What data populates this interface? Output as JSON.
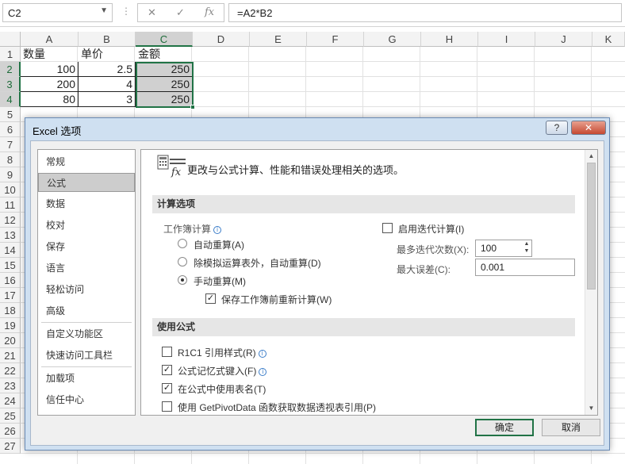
{
  "formula_bar": {
    "name_box": "C2",
    "dots": "⋮",
    "cancel_icon": "✕",
    "enter_icon": "✓",
    "fx_label": "fx",
    "formula": "=A2*B2"
  },
  "columns": [
    "A",
    "B",
    "C",
    "D",
    "E",
    "F",
    "G",
    "H",
    "I",
    "J",
    "K"
  ],
  "rows": [
    "1",
    "2",
    "3",
    "4",
    "5",
    "6",
    "7",
    "8",
    "9",
    "10",
    "11",
    "12",
    "13",
    "14",
    "15",
    "16",
    "17",
    "18",
    "19",
    "20",
    "21",
    "22",
    "23",
    "24",
    "25",
    "26",
    "27"
  ],
  "cells": {
    "a1": "数量",
    "b1": "单价",
    "c1": "金额",
    "a2": "100",
    "b2": "2.5",
    "c2": "250",
    "a3": "200",
    "b3": "4",
    "c3": "250",
    "a4": "80",
    "b4": "3",
    "c4": "250"
  },
  "dialog": {
    "title": "Excel 选项",
    "help_btn": "?",
    "close_btn": "✕",
    "nav": [
      "常规",
      "公式",
      "数据",
      "校对",
      "保存",
      "语言",
      "轻松访问",
      "高级",
      "自定义功能区",
      "快速访问工具栏",
      "加载项",
      "信任中心"
    ],
    "header_icon_label": "fx",
    "header_text": "更改与公式计算、性能和错误处理相关的选项。",
    "calc_section": "计算选项",
    "workbook_calc": "工作簿计算",
    "info_glyph": "i",
    "radio_auto": "自动重算(A)",
    "radio_auto_except": "除模拟运算表外，自动重算(D)",
    "radio_manual": "手动重算(M)",
    "chk_recalc_before_save": "保存工作簿前重新计算(W)",
    "chk_iterative": "启用迭代计算(I)",
    "max_iterations_label": "最多迭代次数(X):",
    "max_iterations_value": "100",
    "max_change_label": "最大误差(C):",
    "max_change_value": "0.001",
    "formulas_section": "使用公式",
    "chk_r1c1": "R1C1 引用样式(R)",
    "chk_autocomplete": "公式记忆式键入(F)",
    "chk_table_names": "在公式中使用表名(T)",
    "chk_getpivot": "使用 GetPivotData 函数获取数据透视表引用(P)",
    "check_glyph": "✓",
    "ok_label": "确定",
    "cancel_label": "取消"
  }
}
